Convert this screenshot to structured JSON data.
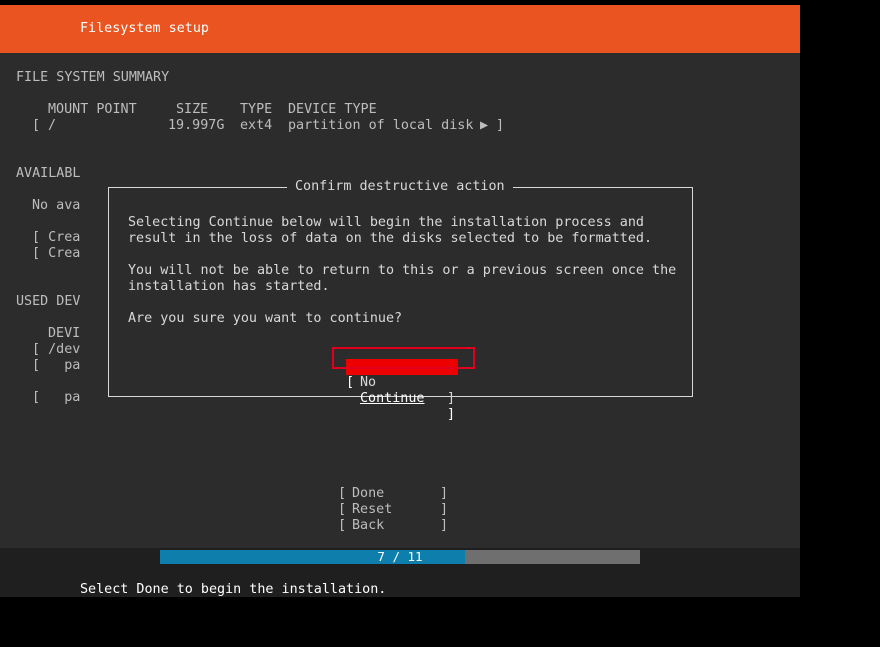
{
  "header": {
    "title": "Filesystem setup"
  },
  "summary": {
    "heading": "FILE SYSTEM SUMMARY",
    "columns": {
      "mount_point": "MOUNT POINT",
      "size": "SIZE",
      "type": "TYPE",
      "device_type": "DEVICE TYPE"
    },
    "row": {
      "open": "[",
      "mount_point": "/",
      "size": "19.997G",
      "type": "ext4",
      "device_type": "partition of local disk",
      "arrow": "▶",
      "close": "]"
    }
  },
  "available": {
    "heading": "AVAILABL",
    "empty_text": "No ava",
    "actions": [
      "[ Crea",
      "[ Crea"
    ]
  },
  "used": {
    "heading": "USED DEV",
    "column": "DEVI",
    "rows": [
      "[ /dev",
      "[   pa",
      "[   pa"
    ]
  },
  "dialog": {
    "title": "Confirm destructive action",
    "para1_line1": "Selecting Continue below will begin the installation process and",
    "para1_line2": "result in the loss of data on the disks selected to be formatted.",
    "para2_line1": "You will not be able to return to this or a previous screen once the",
    "para2_line2": "installation has started.",
    "question": "Are you sure you want to continue?",
    "no_label": "No",
    "continue_label": "Continue"
  },
  "actions": {
    "done": "Done",
    "reset": "Reset",
    "back": "Back"
  },
  "progress": {
    "label": "7 / 11",
    "current": 7,
    "total": 11
  },
  "status": {
    "text": "Select Done to begin the installation."
  },
  "colors": {
    "header": "#e95420",
    "background": "#2c2c2c",
    "selected_button": "#ec0000",
    "progress_fill": "#0e7fac",
    "progress_track": "#6f6f6f"
  }
}
